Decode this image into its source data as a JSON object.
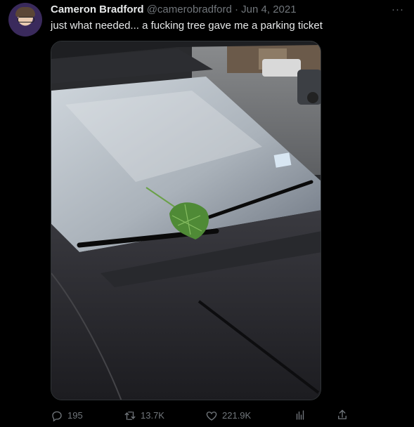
{
  "author": {
    "name": "Cameron Bradford",
    "handle": "@camerobradford",
    "separator": "·",
    "date": "Jun 4, 2021"
  },
  "tweet": {
    "text": "just what needed... a fucking tree gave me a parking ticket"
  },
  "media": {
    "alt": "A leaf resting under the windshield wiper of a dark car"
  },
  "actions": {
    "replies": "195",
    "retweets": "13.7K",
    "likes": "221.9K"
  },
  "more_label": "···",
  "colors": {
    "background": "#000000",
    "text": "#e7e9ea",
    "muted": "#71767b",
    "border": "#2f3336"
  }
}
